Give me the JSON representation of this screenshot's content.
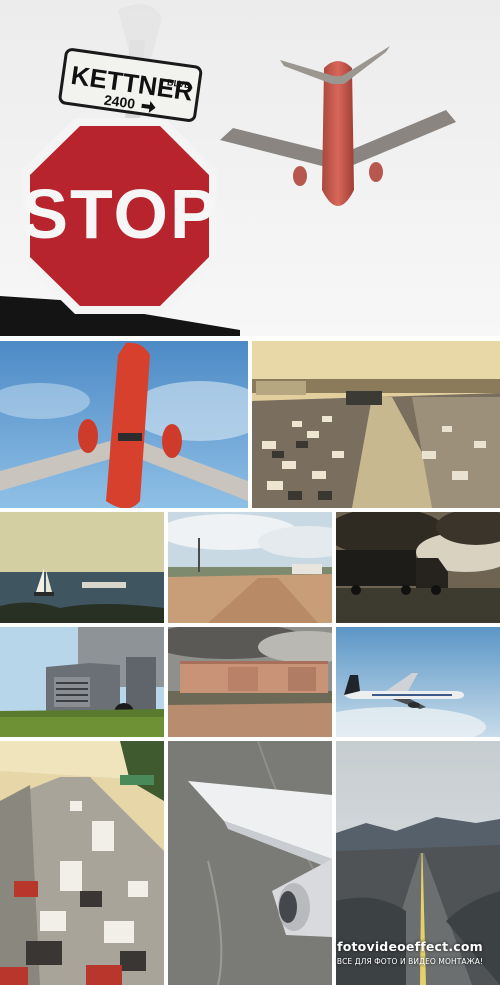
{
  "hero": {
    "street_sign_name": "KETTNER",
    "street_sign_suffix": "BLVD.",
    "street_sign_number": "2400",
    "stop_text": "STOP"
  },
  "tiles": [
    {
      "id": "plane-underside",
      "subject": "red airliner from below, blue sky"
    },
    {
      "id": "freeway-traffic",
      "subject": "congested multi-lane freeway"
    },
    {
      "id": "sailboat",
      "subject": "sailboat and ship on water"
    },
    {
      "id": "dirt-road",
      "subject": "dirt lot under cloudy sky"
    },
    {
      "id": "truck-dark",
      "subject": "semi truck on highway, stormy sky"
    },
    {
      "id": "truck-grass",
      "subject": "semi truck behind grass"
    },
    {
      "id": "boxcar",
      "subject": "abandoned rusty boxcar"
    },
    {
      "id": "jet-sky",
      "subject": "jet flying in blue sky"
    },
    {
      "id": "traffic-jam",
      "subject": "traffic jam on freeway"
    },
    {
      "id": "wing-view",
      "subject": "airplane wing and engine from window"
    },
    {
      "id": "desert-road",
      "subject": "straight road to mountains"
    }
  ],
  "watermark": {
    "site": "fotovideoeffect.com",
    "tagline": "ВСЕ ДЛЯ ФОТО И ВИДЕО МОНТАЖА!"
  },
  "colors": {
    "stop_red": "#b8242e",
    "plane_red": "#c8412f",
    "sky_blue": "#6aa6d8"
  }
}
